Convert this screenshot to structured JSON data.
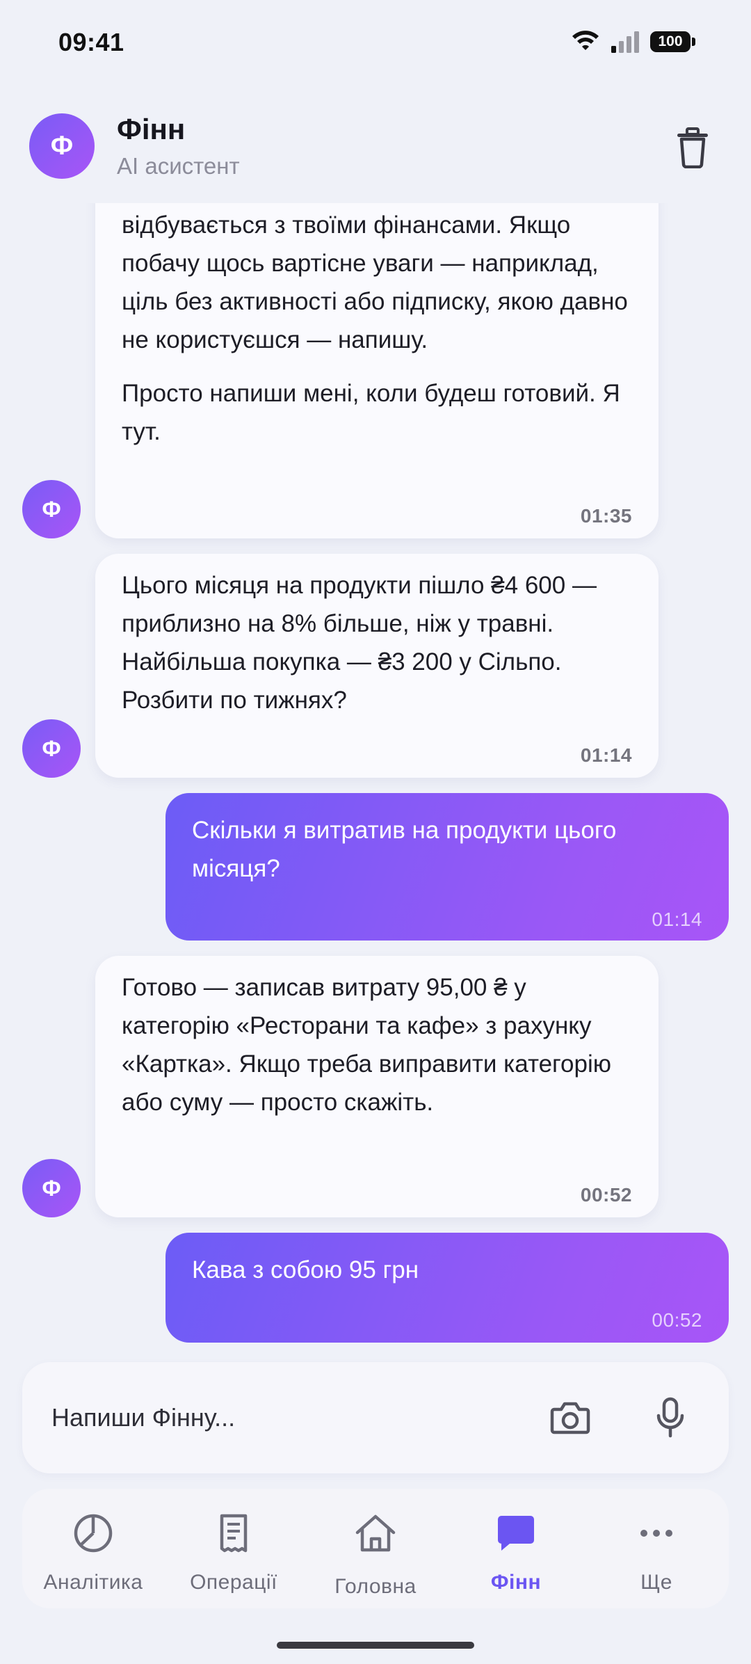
{
  "status_bar": {
    "time": "09:41",
    "battery": "100"
  },
  "header": {
    "avatar_letter": "Ф",
    "name": "Фінн",
    "subtitle": "AI асистент"
  },
  "messages": [
    {
      "from": "assistant",
      "paragraphs": [
        "відбувається з твоїми фінансами. Якщо побачу щось вартісне уваги — наприклад, ціль без активності або підписку, якою давно не користуєшся — напишу.",
        "Просто напиши мені, коли будеш готовий. Я тут."
      ],
      "time": "01:35",
      "avatar": "Ф"
    },
    {
      "from": "assistant",
      "paragraphs": [
        "Цього місяця на продукти пішло ₴4 600 — приблизно на 8% більше, ніж у травні. Найбільша покупка — ₴3 200 у Сільпо. Розбити по тижнях?"
      ],
      "time": "01:14",
      "avatar": "Ф"
    },
    {
      "from": "user",
      "text": "Скільки я витратив на продукти цього місяця?",
      "time": "01:14"
    },
    {
      "from": "assistant",
      "paragraphs": [
        "Готово — записав витрату 95,00 ₴ у категорію «Ресторани та кафе» з рахунку «Картка». Якщо треба виправити категорію або суму — просто скажіть."
      ],
      "time": "00:52",
      "avatar": "Ф"
    },
    {
      "from": "user",
      "text": "Кава з собою 95 грн",
      "time": "00:52"
    }
  ],
  "composer": {
    "placeholder": "Напиши Фінну..."
  },
  "nav": [
    {
      "label": "Аналітика",
      "icon": "pie-chart-icon",
      "active": false
    },
    {
      "label": "Операції",
      "icon": "receipt-icon",
      "active": false
    },
    {
      "label": "Головна",
      "icon": "home-icon",
      "active": false
    },
    {
      "label": "Фінн",
      "icon": "chat-bubble-icon",
      "active": true
    },
    {
      "label": "Ще",
      "icon": "more-dots-icon",
      "active": false
    }
  ],
  "colors": {
    "accent": "#6b55f2",
    "accent_gradient_end": "#a855f7",
    "background": "#eff1f8",
    "bubble_in": "#fafafe"
  }
}
